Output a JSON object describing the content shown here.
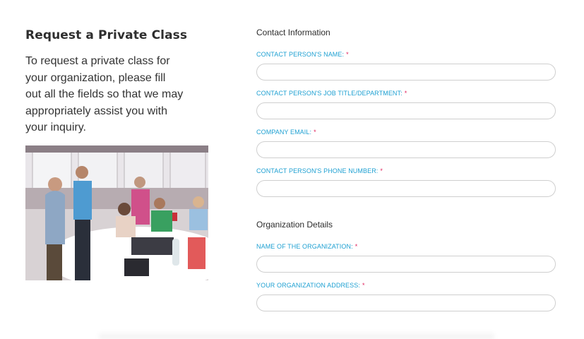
{
  "intro": {
    "heading": "Request a Private Class",
    "text": "To request a private class for your organization, please fill out all the fields so that we may appropriately assist you with your inquiry."
  },
  "photo": {
    "icon": "team-meeting-photo"
  },
  "contact": {
    "title": "Contact Information",
    "fields": [
      {
        "label": "CONTACT PERSON'S NAME:",
        "required": "*",
        "value": ""
      },
      {
        "label": "CONTACT PERSON'S JOB TITLE/DEPARTMENT:",
        "required": "*",
        "value": ""
      },
      {
        "label": "COMPANY EMAIL:",
        "required": "*",
        "value": ""
      },
      {
        "label": "CONTACT PERSON'S PHONE NUMBER:",
        "required": "*",
        "value": ""
      }
    ]
  },
  "organization": {
    "title": "Organization Details",
    "fields": [
      {
        "label": "NAME OF THE ORGANIZATION:",
        "required": "*",
        "value": ""
      },
      {
        "label": "YOUR ORGANIZATION ADDRESS:",
        "required": "*",
        "value": ""
      }
    ]
  },
  "colors": {
    "label": "#1ea0d2",
    "required": "#e0245e",
    "heading": "#2e2e2e"
  }
}
